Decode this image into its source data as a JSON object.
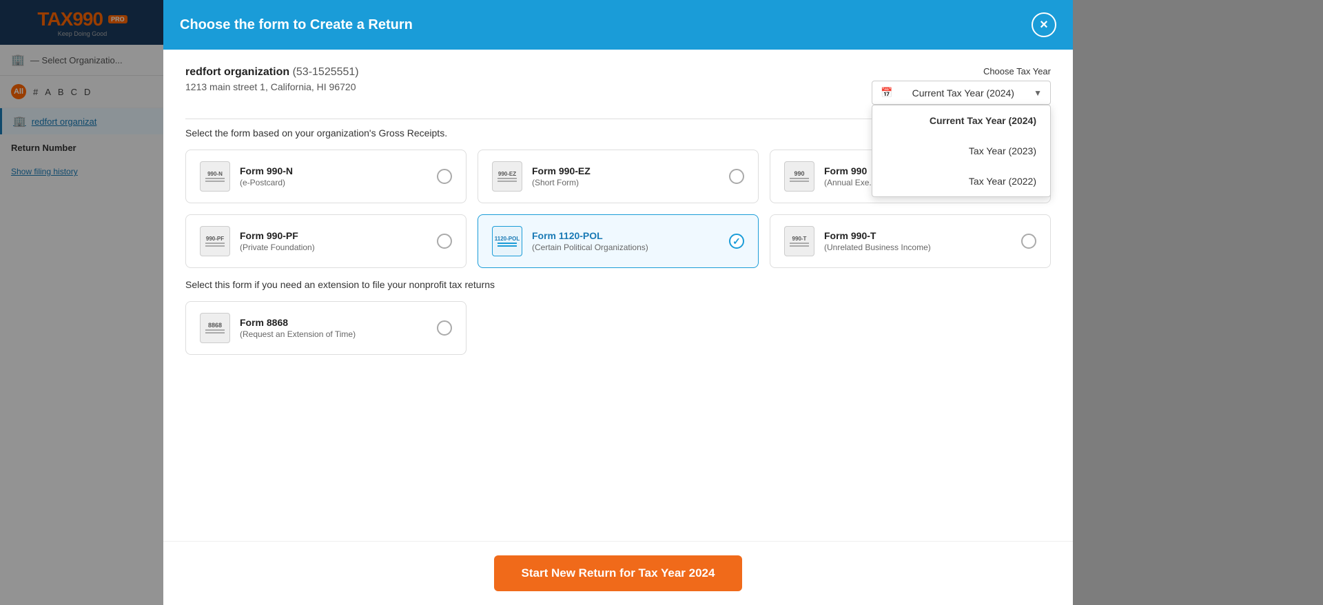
{
  "app": {
    "logo": "TAX990",
    "pro_badge": "PRO",
    "tagline": "Keep Doing Good",
    "select_org_placeholder": "— Select Organizatio...",
    "alpha_labels": [
      "All",
      "#",
      "A",
      "B",
      "C",
      "D"
    ],
    "org_name": "redfort organizat",
    "return_header": "Return Number",
    "show_history": "Show filing history"
  },
  "modal": {
    "title": "Choose the form to Create a Return",
    "close_label": "×",
    "org": {
      "name": "redfort organization",
      "ein": "(53-1525551)",
      "address": "1213 main street 1, California, HI 96720"
    },
    "tax_year_section": {
      "label": "Choose Tax Year",
      "current_value": "Current Tax Year (2024)",
      "options": [
        {
          "label": "Current Tax Year (2024)",
          "value": "2024"
        },
        {
          "label": "Tax Year (2023)",
          "value": "2023"
        },
        {
          "label": "Tax Year (2022)",
          "value": "2022"
        }
      ]
    },
    "gross_receipts_label": "Select the form based on your organization's Gross Receipts.",
    "forms": [
      {
        "id": "990n",
        "code": "990-N",
        "name": "Form 990-N",
        "desc": "(e-Postcard)",
        "selected": false
      },
      {
        "id": "990ez",
        "code": "990-EZ",
        "name": "Form 990-EZ",
        "desc": "(Short Form)",
        "selected": false
      },
      {
        "id": "990",
        "code": "990",
        "name": "Form 990",
        "desc": "(Annual Exe...",
        "selected": false
      },
      {
        "id": "990pf",
        "code": "990-PF",
        "name": "Form 990-PF",
        "desc": "(Private Foundation)",
        "selected": false
      },
      {
        "id": "1120pol",
        "code": "1120-POL",
        "name": "Form 1120-POL",
        "desc": "(Certain Political Organizations)",
        "selected": true
      },
      {
        "id": "990t",
        "code": "990-T",
        "name": "Form 990-T",
        "desc": "(Unrelated Business Income)",
        "selected": false
      }
    ],
    "extension_label": "Select this form if you need an extension to file your nonprofit tax returns",
    "extension_forms": [
      {
        "id": "8868",
        "code": "8868",
        "name": "Form 8868",
        "desc": "(Request an Extension of Time)",
        "selected": false
      }
    ],
    "start_button": "Start New Return for Tax Year 2024"
  }
}
